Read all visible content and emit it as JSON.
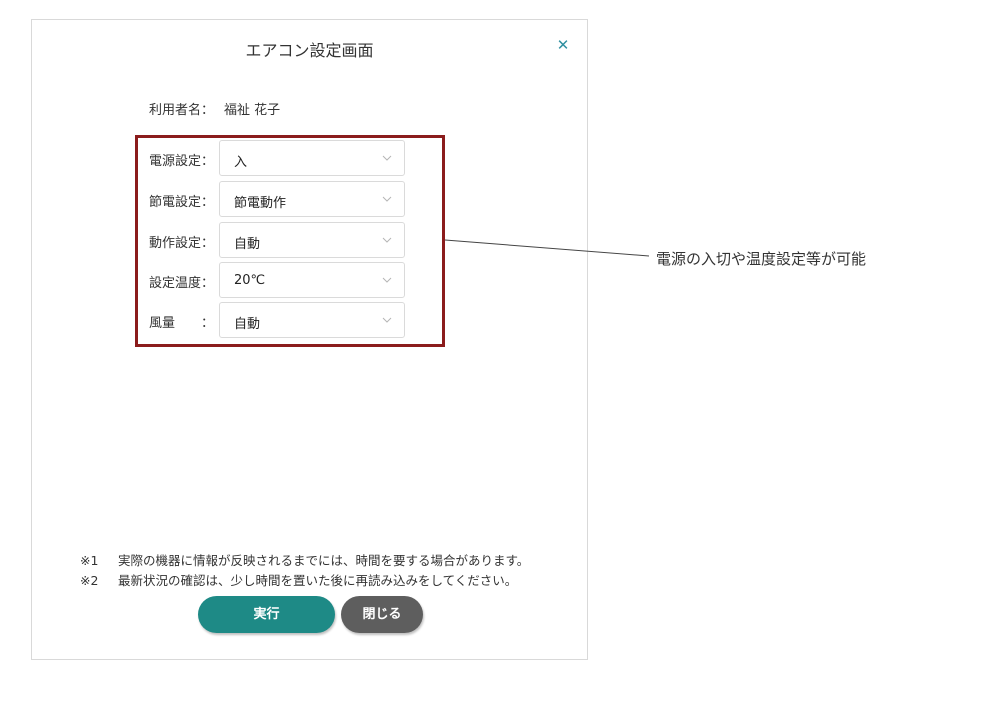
{
  "dialog": {
    "title": "エアコン設定画面",
    "close_icon": "close-icon"
  },
  "user": {
    "label": "利用者名：",
    "name": "福祉 花子"
  },
  "settings": [
    {
      "label": "電源設定：",
      "value": "入"
    },
    {
      "label": "節電設定：",
      "value": "節電動作"
    },
    {
      "label": "動作設定：",
      "value": "自動"
    },
    {
      "label": "設定温度：",
      "value": "20℃"
    },
    {
      "label": "風量　　：",
      "value": "自動"
    }
  ],
  "callout": {
    "text": "電源の入切や温度設定等が可能",
    "box_color": "#8b1c1c"
  },
  "notes": [
    {
      "mark": "※1",
      "text": "実際の機器に情報が反映されるまでには、時間を要する場合があります。"
    },
    {
      "mark": "※2",
      "text": "最新状況の確認は、少し時間を置いた後に再読み込みをしてください。"
    }
  ],
  "buttons": {
    "execute": "実行",
    "close": "閉じる"
  },
  "colors": {
    "execute_button": "#1e8a86",
    "close_button": "#5e5e5e",
    "close_icon": "#2f8fa0"
  }
}
